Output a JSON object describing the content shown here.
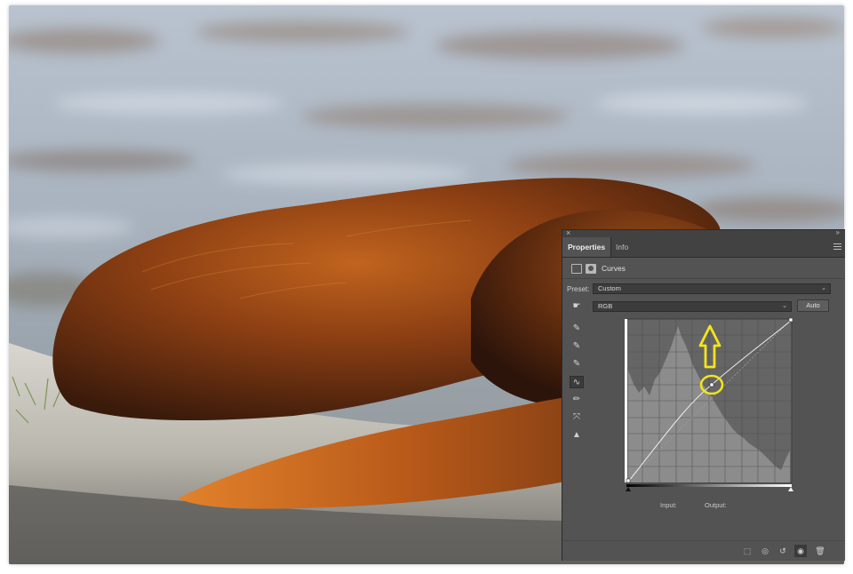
{
  "panel": {
    "tabs": [
      "Properties",
      "Info"
    ],
    "adjustment_label": "Curves",
    "preset_label": "Preset:",
    "preset_value": "Custom",
    "channel_value": "RGB",
    "auto_label": "Auto",
    "input_label": "Input:",
    "output_label": "Output:"
  },
  "icons": {
    "close": "×",
    "collapse": "»",
    "tools": [
      "sample-in-image-icon",
      "black-point-eyedropper-icon",
      "gray-point-eyedropper-icon",
      "white-point-eyedropper-icon",
      "curve-point-tool-icon",
      "pencil-tool-icon",
      "smooth-icon",
      "clipping-warning-icon"
    ],
    "bottom": [
      "clip-to-layer-icon",
      "view-previous-state-icon",
      "reset-icon",
      "visibility-icon",
      "delete-icon"
    ]
  },
  "colors": {
    "panel_bg": "#535353",
    "annotation": "#f2e51a",
    "fur": "#8a3f12"
  }
}
